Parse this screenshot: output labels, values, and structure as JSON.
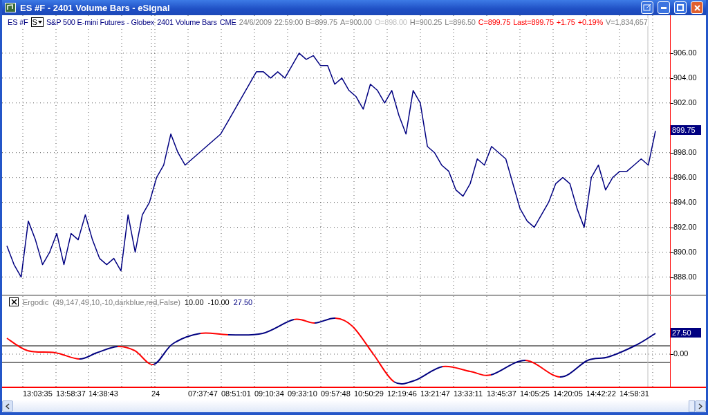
{
  "window": {
    "title": "ES #F - 2401 Volume Bars - eSignal"
  },
  "quote_bar": {
    "symbol": "ES #F",
    "menu_button": "S",
    "items": [
      {
        "text": "S&P 500 E-mini Futures - Globex",
        "color": "#000080"
      },
      {
        "text": "2401 Volume Bars",
        "color": "#000080"
      },
      {
        "text": "CME",
        "color": "#000080"
      },
      {
        "text": "24/6/2009",
        "color": "#808080"
      },
      {
        "text": "22:59:00",
        "color": "#808080"
      },
      {
        "text": "B=899.75",
        "color": "#808080"
      },
      {
        "text": "A=900.00",
        "color": "#808080"
      },
      {
        "text": "O=898.00",
        "color": "#c0c0c0"
      },
      {
        "text": "H=900.25",
        "color": "#808080"
      },
      {
        "text": "L=896.50",
        "color": "#808080"
      },
      {
        "text": "C=899.75",
        "color": "#ff0000"
      },
      {
        "text": "Last=899.75",
        "color": "#ff0000"
      },
      {
        "text": "+1.75",
        "color": "#ff0000"
      },
      {
        "text": "+0.19%",
        "color": "#ff0000"
      },
      {
        "text": "V=1,834,657",
        "color": "#808080"
      }
    ]
  },
  "price_panel": {
    "last_price": "899.75",
    "chart_data": {
      "type": "line",
      "grid": true,
      "ylim": [
        879.3,
        909.05
      ],
      "yticks": [
        {
          "value": 906,
          "label": "906.00"
        },
        {
          "value": 904,
          "label": "904.00"
        },
        {
          "value": 902,
          "label": "902.00"
        },
        {
          "value": 898,
          "label": "898.00"
        },
        {
          "value": 896,
          "label": "896.00"
        },
        {
          "value": 894,
          "label": "894.00"
        },
        {
          "value": 892,
          "label": "892.00"
        },
        {
          "value": 890,
          "label": "890.00"
        },
        {
          "value": 888,
          "label": "888.00"
        }
      ],
      "series": [
        {
          "color": "#000080",
          "values": [
            890.5,
            889,
            888,
            892.5,
            891,
            889,
            890,
            891.5,
            889,
            891.5,
            891,
            893,
            891,
            889.5,
            889,
            889.5,
            888.5,
            893,
            890,
            893,
            894,
            896,
            897,
            899.5,
            898,
            897,
            897.5,
            898,
            898.5,
            899,
            899.5,
            900.5,
            901.5,
            902.5,
            903.5,
            904.5,
            904.5,
            904,
            904.5,
            904,
            905,
            906,
            905.5,
            905.8,
            905,
            905,
            903.5,
            904,
            903,
            902.5,
            901.5,
            903.5,
            903,
            902,
            903,
            901,
            899.5,
            903,
            902,
            898.5,
            898,
            897,
            896.5,
            895,
            894.5,
            895.5,
            897.5,
            897,
            898.5,
            898,
            897.5,
            895.5,
            893.5,
            892.5,
            892,
            893,
            894,
            895.5,
            896,
            895.5,
            893.5,
            892,
            896,
            897,
            895,
            896,
            896.5,
            896.5,
            897,
            897.5,
            897,
            899.75
          ]
        }
      ]
    }
  },
  "indicator_panel": {
    "name": "Ergodic",
    "params": "(49,147,49,10,-10,darkblue,red,False)",
    "levels": [
      "10.00",
      "-10.00"
    ],
    "current": "27.50",
    "axis_label": "0.00",
    "last_value": "27.50"
  },
  "time_axis": {
    "labels": [
      "13:03:35",
      "13:58:37",
      "14:38:43",
      "24",
      "07:37:47",
      "08:51:01",
      "09:10:34",
      "09:33:10",
      "09:57:48",
      "10:50:29",
      "12:19:46",
      "13:21:47",
      "13:33:11",
      "13:45:37",
      "14:05:25",
      "14:20:05",
      "14:42:22",
      "14:58:31"
    ]
  }
}
